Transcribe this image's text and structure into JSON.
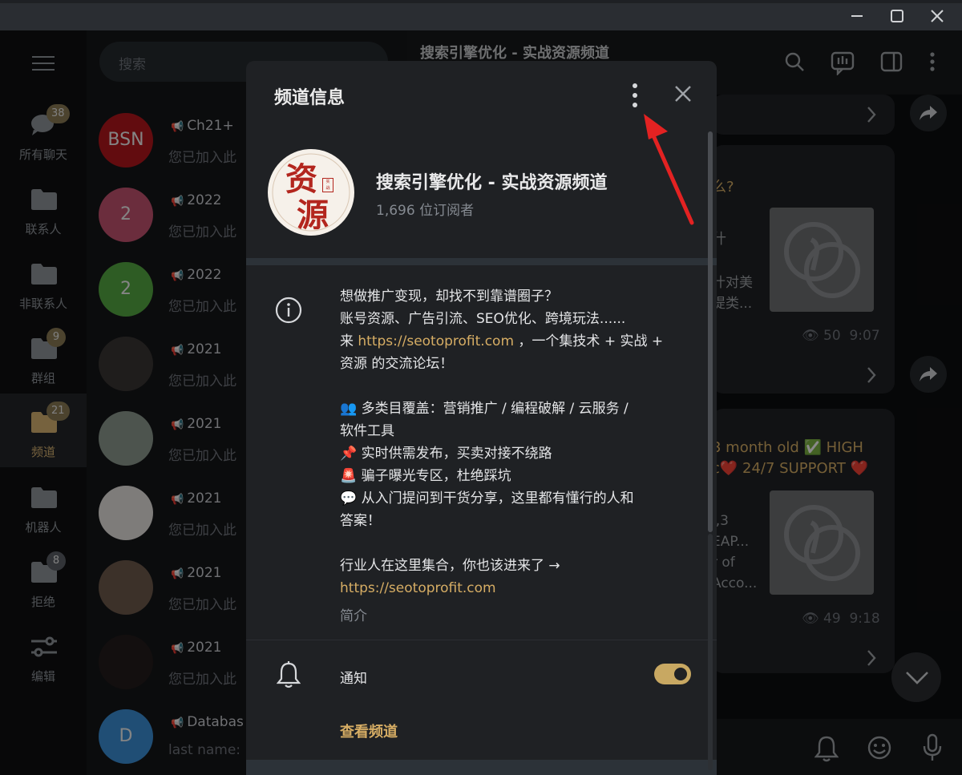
{
  "window": {
    "controls": [
      "minimize",
      "maximize",
      "close"
    ]
  },
  "rail": {
    "folders": [
      {
        "label": "所有聊天",
        "icon": "chat-bubbles-icon",
        "badge": "38"
      },
      {
        "label": "联系人",
        "icon": "folder-icon",
        "badge": ""
      },
      {
        "label": "非联系人",
        "icon": "folder-icon",
        "badge": ""
      },
      {
        "label": "群组",
        "icon": "folder-icon",
        "badge": "9"
      },
      {
        "label": "频道",
        "icon": "folder-icon",
        "badge": "21",
        "active": true
      },
      {
        "label": "机器人",
        "icon": "folder-icon",
        "badge": ""
      },
      {
        "label": "拒绝",
        "icon": "folder-icon",
        "badge": "8"
      },
      {
        "label": "编辑",
        "icon": "sliders-icon",
        "badge": ""
      }
    ]
  },
  "chatlist": {
    "search_placeholder": "搜索",
    "chats": [
      {
        "avatar_text": "BSN",
        "avatar_color": "#b3171d",
        "title": "Ch21+",
        "preview": "您已加入此"
      },
      {
        "avatar_text": "2",
        "avatar_color": "#c4536f",
        "title": "2022",
        "preview": "您已加入此"
      },
      {
        "avatar_text": "2",
        "avatar_color": "#55a842",
        "title": "2022",
        "preview": "您已加入此"
      },
      {
        "avatar_text": "",
        "avatar_color": "#3a3633",
        "title": "2021",
        "preview": "您已加入此"
      },
      {
        "avatar_text": "",
        "avatar_color": "#8d9a8f",
        "title": "2021",
        "preview": "您已加入此"
      },
      {
        "avatar_text": "",
        "avatar_color": "#e5e2df",
        "title": "2021",
        "preview": "您已加入此"
      },
      {
        "avatar_text": "",
        "avatar_color": "#6d5a4c",
        "title": "2021",
        "preview": "您已加入此"
      },
      {
        "avatar_text": "",
        "avatar_color": "#241c1c",
        "title": "2021",
        "preview": "您已加入此"
      },
      {
        "avatar_text": "D",
        "avatar_color": "#3b8fd6",
        "title": "Databas",
        "preview": "last name:"
      }
    ]
  },
  "chat": {
    "title": "搜索引擎优化 - 实战资源频道",
    "fragments": {
      "q": "么?",
      "shi": "什",
      "dui_mei": "什对美",
      "ti_lei": "提类...",
      "views1": "50",
      "time1": "9:07",
      "month_old": "3 month old ✅ HIGH",
      "support": "c❤️ 24/7 SUPPORT ❤️",
      "l3": "l,3",
      "eap": "EAP...",
      "r_of": "r of",
      "acco": "Acco...",
      "views2": "49",
      "time2": "9:18"
    }
  },
  "modal": {
    "title": "频道信息",
    "channel_name": "搜索引擎优化 - 实战资源频道",
    "subscribers": "1,696 位订阅者",
    "avatar_chars": [
      "资",
      "源"
    ],
    "description_lines": [
      "想做推广变现，却找不到靠谱圈子？",
      "账号资源、广告引流、SEO优化、跨境玩法......",
      "",
      "资源 的交流论坛！",
      "",
      "👥 多类目覆盖：营销推广 / 编程破解 / 云服务 /",
      "软件工具",
      "📌 实时供需发布，买卖对接不绕路",
      "🚨 骗子曝光专区，杜绝踩坑",
      "💬 从入门提问到干货分享，这里都有懂行的人和",
      "答案！",
      "",
      "行业人在这里集合，你也该进来了 →"
    ],
    "line3_prefix": "来 ",
    "line3_link": "https://seotoprofit.com",
    "line3_suffix": " ，一个集技术 + 实战 +",
    "final_link": "https://seotoprofit.com",
    "description_label": "简介",
    "notify_label": "通知",
    "notify_on": true,
    "view_channel": "查看频道",
    "accent": "#d6ad64"
  }
}
